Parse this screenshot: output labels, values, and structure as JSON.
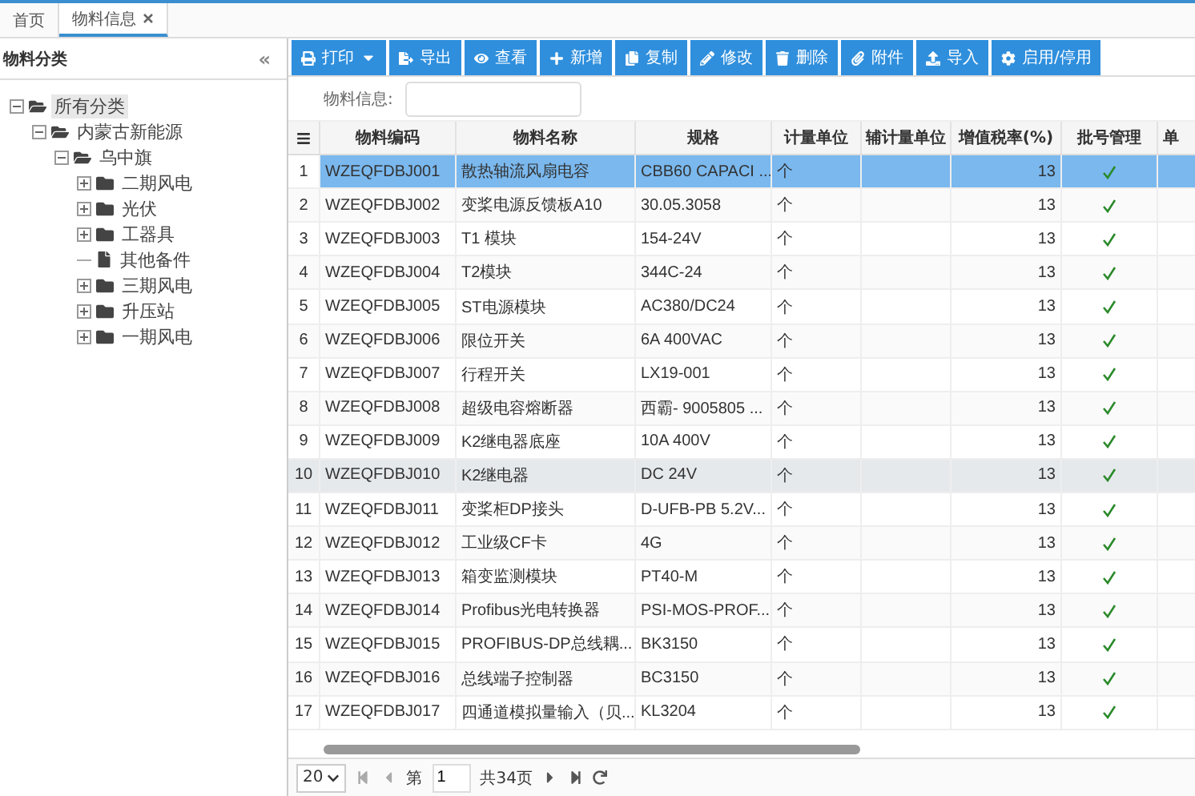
{
  "tabs": [
    {
      "label": "首页",
      "selected": false,
      "closable": false
    },
    {
      "label": "物料信息",
      "selected": true,
      "closable": true
    }
  ],
  "sidebar": {
    "title": "物料分类",
    "collapse": "«",
    "tree": [
      {
        "label": "所有分类",
        "kind": "folder",
        "selected": true,
        "expanded": true,
        "children": [
          {
            "label": "内蒙古新能源",
            "kind": "folder",
            "selected": false,
            "expanded": true,
            "children": [
              {
                "label": "乌中旗",
                "kind": "folder",
                "selected": false,
                "expanded": true,
                "children": [
                  {
                    "label": "二期风电",
                    "kind": "folder",
                    "selected": false,
                    "expanded": false
                  },
                  {
                    "label": "光伏",
                    "kind": "folder",
                    "selected": false,
                    "expanded": false
                  },
                  {
                    "label": "工器具",
                    "kind": "folder",
                    "selected": false,
                    "expanded": false
                  },
                  {
                    "label": "其他备件",
                    "kind": "leaf",
                    "selected": false
                  },
                  {
                    "label": "三期风电",
                    "kind": "folder",
                    "selected": false,
                    "expanded": false
                  },
                  {
                    "label": "升压站",
                    "kind": "folder",
                    "selected": false,
                    "expanded": false
                  },
                  {
                    "label": "一期风电",
                    "kind": "folder",
                    "selected": false,
                    "expanded": false
                  }
                ]
              }
            ]
          }
        ]
      }
    ]
  },
  "toolbar": [
    {
      "label": "打印",
      "dropdown": true
    },
    {
      "label": "导出",
      "dropdown": false
    },
    {
      "label": "查看",
      "dropdown": false
    },
    {
      "label": "新增",
      "dropdown": false
    },
    {
      "label": "复制",
      "dropdown": false
    },
    {
      "label": "修改",
      "dropdown": false
    },
    {
      "label": "删除",
      "dropdown": false
    },
    {
      "label": "附件",
      "dropdown": false
    },
    {
      "label": "导入",
      "dropdown": false
    },
    {
      "label": "启用/停用",
      "dropdown": false
    }
  ],
  "search": {
    "label": "物料信息:"
  },
  "table": {
    "columns": [
      "物料编码",
      "物料名称",
      "规格",
      "计量单位",
      "辅计量单位",
      "增值税率(%)",
      "批号管理",
      "单"
    ],
    "rows": [
      {
        "no": "1",
        "code": "WZEQFDBJ001",
        "name": "散热轴流风扇电容",
        "spec": "CBB60 CAPACI ...",
        "unit": "个",
        "tax": "13",
        "batch": true,
        "selected": true,
        "hovered": false
      },
      {
        "no": "2",
        "code": "WZEQFDBJ002",
        "name": "变桨电源反馈板A10",
        "spec": "30.05.3058",
        "unit": "个",
        "tax": "13",
        "batch": true,
        "selected": false,
        "hovered": false
      },
      {
        "no": "3",
        "code": "WZEQFDBJ003",
        "name": "T1 模块",
        "spec": "154-24V",
        "unit": "个",
        "tax": "13",
        "batch": true,
        "selected": false,
        "hovered": false
      },
      {
        "no": "4",
        "code": "WZEQFDBJ004",
        "name": "T2模块",
        "spec": "344C-24",
        "unit": "个",
        "tax": "13",
        "batch": true,
        "selected": false,
        "hovered": false
      },
      {
        "no": "5",
        "code": "WZEQFDBJ005",
        "name": "ST电源模块",
        "spec": "AC380/DC24",
        "unit": "个",
        "tax": "13",
        "batch": true,
        "selected": false,
        "hovered": false
      },
      {
        "no": "6",
        "code": "WZEQFDBJ006",
        "name": "限位开关",
        "spec": "6A 400VAC",
        "unit": "个",
        "tax": "13",
        "batch": true,
        "selected": false,
        "hovered": false
      },
      {
        "no": "7",
        "code": "WZEQFDBJ007",
        "name": "行程开关",
        "spec": "LX19-001",
        "unit": "个",
        "tax": "13",
        "batch": true,
        "selected": false,
        "hovered": false
      },
      {
        "no": "8",
        "code": "WZEQFDBJ008",
        "name": "超级电容熔断器",
        "spec": "西霸- 9005805 ...",
        "unit": "个",
        "tax": "13",
        "batch": true,
        "selected": false,
        "hovered": false
      },
      {
        "no": "9",
        "code": "WZEQFDBJ009",
        "name": "K2继电器底座",
        "spec": "10A 400V",
        "unit": "个",
        "tax": "13",
        "batch": true,
        "selected": false,
        "hovered": false
      },
      {
        "no": "10",
        "code": "WZEQFDBJ010",
        "name": "K2继电器",
        "spec": "DC 24V",
        "unit": "个",
        "tax": "13",
        "batch": true,
        "selected": false,
        "hovered": true
      },
      {
        "no": "11",
        "code": "WZEQFDBJ011",
        "name": "变桨柜DP接头",
        "spec": "D-UFB-PB 5.2V...",
        "unit": "个",
        "tax": "13",
        "batch": true,
        "selected": false,
        "hovered": false
      },
      {
        "no": "12",
        "code": "WZEQFDBJ012",
        "name": "工业级CF卡",
        "spec": "4G",
        "unit": "个",
        "tax": "13",
        "batch": true,
        "selected": false,
        "hovered": false
      },
      {
        "no": "13",
        "code": "WZEQFDBJ013",
        "name": "箱变监测模块",
        "spec": "PT40-M",
        "unit": "个",
        "tax": "13",
        "batch": true,
        "selected": false,
        "hovered": false
      },
      {
        "no": "14",
        "code": "WZEQFDBJ014",
        "name": "Profibus光电转换器",
        "spec": "PSI-MOS-PROF...",
        "unit": "个",
        "tax": "13",
        "batch": true,
        "selected": false,
        "hovered": false
      },
      {
        "no": "15",
        "code": "WZEQFDBJ015",
        "name": "PROFIBUS-DP总线耦...",
        "spec": "BK3150",
        "unit": "个",
        "tax": "13",
        "batch": true,
        "selected": false,
        "hovered": false
      },
      {
        "no": "16",
        "code": "WZEQFDBJ016",
        "name": "总线端子控制器",
        "spec": "BC3150",
        "unit": "个",
        "tax": "13",
        "batch": true,
        "selected": false,
        "hovered": false
      },
      {
        "no": "17",
        "code": "WZEQFDBJ017",
        "name": "四通道模拟量输入（贝...",
        "spec": "KL3204",
        "unit": "个",
        "tax": "13",
        "batch": true,
        "selected": false,
        "hovered": false
      }
    ]
  },
  "pager": {
    "page_size": "20",
    "page_label": "第",
    "page": "1",
    "total": "共34页"
  }
}
